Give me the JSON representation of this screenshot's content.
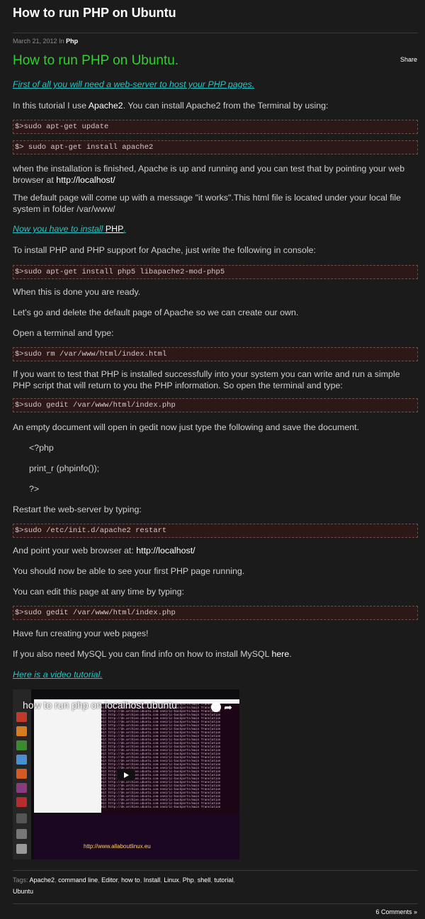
{
  "page_title": "How to run PHP on Ubuntu",
  "meta": {
    "date": "March 21, 2012",
    "in_word": "In",
    "category": "Php"
  },
  "post_title": "How to run PHP on Ubuntu.",
  "share_label": "Share",
  "content": {
    "p1_link": "First of all you will need a web-server to host your PHP pages.",
    "p2_prefix": "In this tutorial I use ",
    "p2_link": "Apache2",
    "p2_suffix": ". You can install Apache2 from the Terminal by using:",
    "code1": "$>sudo apt-get update",
    "code2": "$> sudo apt-get install apache2",
    "p3_prefix": "when the installation is finished, Apache is up and running and you can test that by pointing your web browser at ",
    "p3_link": "http://localhost/",
    "p4": "The default page will come up with a message \"it works\".This html file is located under your local file system in folder /var/www/",
    "p5_text": "Now you have to install ",
    "p5_link": "PHP",
    "p5_end": ".",
    "p6": "To install PHP and PHP support for Apache, just write the following in console:",
    "code3": "$>sudo apt-get install php5 libapache2-mod-php5",
    "p7": "When this is done you are ready.",
    "p8": "Let's go and delete the default page of Apache so we can create our own.",
    "p9": "Open a terminal and type:",
    "code4": "$>sudo rm /var/www/html/index.html",
    "p10": "If you want to test that PHP is installed successfully into your system you can write and run a simple PHP script that will return to you the PHP information. So open the terminal and type:",
    "code5": "$>sudo gedit /var/www/html/index.php",
    "p11": "An empty document will open in gedit now just type the following and save the document.",
    "php_open": "<?php",
    "php_body": "print_r (phpinfo());",
    "php_close": "?>",
    "p12": "Restart the web-server by typing:",
    "code6": "$>sudo /etc/init.d/apache2 restart",
    "p13_prefix": "And point your web browser at: ",
    "p13_link": "http://localhost/",
    "p14": "You should now be able to see your first PHP page running.",
    "p15": "You can edit this page at any time by typing:",
    "code7": "$>sudo gedit /var/www/html/index.php",
    "p16": "Have fun creating your web pages!",
    "p17_prefix": "If you also need MySQL you can find info on how to install MySQL ",
    "p17_link": "here",
    "p17_end": ".",
    "p18_link": "Here is a video tutorial."
  },
  "video": {
    "title": "how to run php on localhost ubuntu",
    "url_text": "http://www.allaboutlinux.eu"
  },
  "tags": {
    "label": "Tags:",
    "items": [
      "Apache2",
      "command line",
      "Editor",
      "how to",
      "Install",
      "Linux",
      "Php",
      "shell",
      "tutorial",
      "Ubuntu"
    ]
  },
  "comments_label": "6 Comments »",
  "colors": {
    "accent_green": "#2ed12e",
    "link_teal": "#28c5c5",
    "background": "#1b1b1b",
    "code_bg": "#2d1818"
  }
}
